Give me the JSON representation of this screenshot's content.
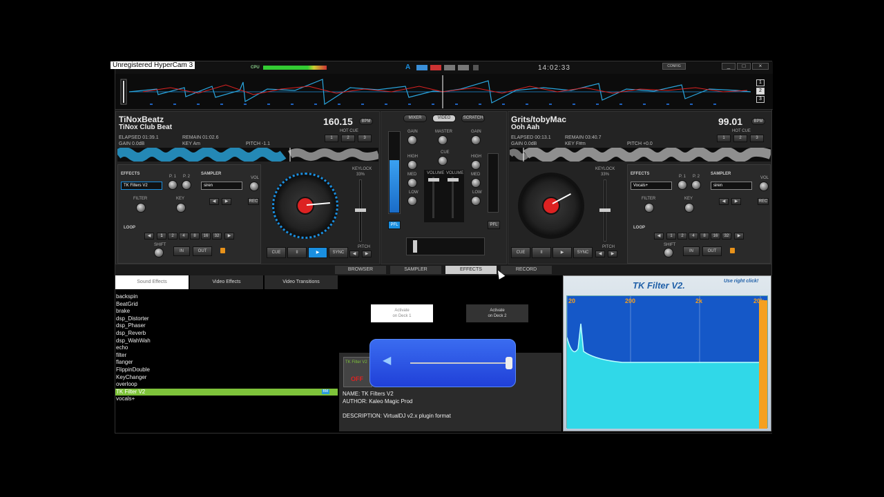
{
  "watermark": "Unregistered HyperCam 3",
  "topbar": {
    "cpu_label": "CPU",
    "clock": "14:02:33",
    "config_label": "CONFIG",
    "min": "_",
    "max": "□",
    "close": "×",
    "logo": "A"
  },
  "waveform_pages": [
    "1",
    "2",
    "3"
  ],
  "deck_left": {
    "artist": "TiNoxBeatz",
    "track": "TiNox Club Beat",
    "bpm": "160.15",
    "bpm_label": "BPM",
    "elapsed": "ELAPSED 01:39.1",
    "remain": "REMAIN 01:02.6",
    "gain": "GAIN 0.0dB",
    "key": "KEY Am",
    "pitch": "PITCH -1.1",
    "hot_cue_label": "HOT CUE",
    "hot_cues": [
      "1",
      "2",
      "3"
    ],
    "effects_label": "EFFECTS",
    "effect_selected": "TK Filters V2",
    "p1": "P. 1",
    "p2": "P. 2",
    "sampler_label": "SAMPLER",
    "sampler_selected": "siren",
    "vol": "VOL",
    "rec": "REC",
    "filter": "FILTER",
    "key_knob": "KEY",
    "loop_label": "LOOP",
    "loop_values": [
      "1",
      "2",
      "4",
      "8",
      "16",
      "32"
    ],
    "shift": "SHIFT",
    "in": "IN",
    "out": "OUT",
    "keylock": "KEYLOCK",
    "keylock_pct": "33%",
    "pitch_label": "PITCH",
    "cue": "CUE",
    "pause": "II",
    "play": "▶",
    "sync": "SYNC"
  },
  "deck_right": {
    "artist": "Grits/tobyMac",
    "track": "Ooh Aah",
    "bpm": "99.01",
    "bpm_label": "BPM",
    "elapsed": "ELAPSED 00:13.1",
    "remain": "REMAIN 03:40.7",
    "gain": "GAIN 0.0dB",
    "key": "KEY F#m",
    "pitch": "PITCH +0.0",
    "hot_cue_label": "HOT CUE",
    "hot_cues": [
      "1",
      "2",
      "3"
    ],
    "effects_label": "EFFECTS",
    "effect_selected": "Vocals+",
    "p1": "P. 1",
    "p2": "P. 2",
    "sampler_label": "SAMPLER",
    "sampler_selected": "siren",
    "vol": "VOL",
    "rec": "REC",
    "filter": "FILTER",
    "key_knob": "KEY",
    "loop_label": "LOOP",
    "loop_values": [
      "1",
      "2",
      "4",
      "8",
      "16",
      "32"
    ],
    "shift": "SHIFT",
    "in": "IN",
    "out": "OUT",
    "keylock": "KEYLOCK",
    "keylock_pct": "33%",
    "pitch_label": "PITCH",
    "cue": "CUE",
    "pause": "II",
    "play": "▶",
    "sync": "SYNC"
  },
  "mixer": {
    "tabs": [
      "MIXER",
      "VIDEO",
      "SCRATCH"
    ],
    "gain": "GAIN",
    "master": "MASTER",
    "high": "HIGH",
    "cue": "CUE",
    "med": "MED",
    "low": "LOW",
    "volume": "VOLUME",
    "pfl": "PFL"
  },
  "main_tabs": [
    "BROWSER",
    "SAMPLER",
    "EFFECTS",
    "RECORD"
  ],
  "effect_tabs": [
    "Sound Effects",
    "Video Effects",
    "Video Transitions"
  ],
  "effects_list": [
    "backspin",
    "BeatGrid",
    "brake",
    "dsp_Distorter",
    "dsp_Phaser",
    "dsp_Reverb",
    "dsp_WahWah",
    "echo",
    "filter",
    "flanger",
    "FlippinDouble",
    "KeyChanger",
    "overloop",
    "TK Filter V2",
    "vocals+"
  ],
  "selected_effect_badge": "BM",
  "activate_deck1": {
    "line1": "Activate",
    "line2": "on Deck 1"
  },
  "activate_deck2": {
    "line1": "Activate",
    "line2": "on Deck 2"
  },
  "plugin": {
    "thumb_text": "TK Filter V2",
    "thumb_state": "OFF",
    "name": "NAME: TK Filters V2",
    "author": "AUTHOR: Kaleo Magic Prod",
    "description": "DESCRIPTION: VirtualDJ v2.x plugin format"
  },
  "tk_panel": {
    "title": "TK Filter  V2.",
    "hint": "Use right click!",
    "freq_labels": [
      "20",
      "200",
      "2k",
      "20k"
    ]
  },
  "colors": {
    "accent": "#1a8fe0",
    "selected": "#7ec33a",
    "filter_fill": "#30d8e8"
  }
}
